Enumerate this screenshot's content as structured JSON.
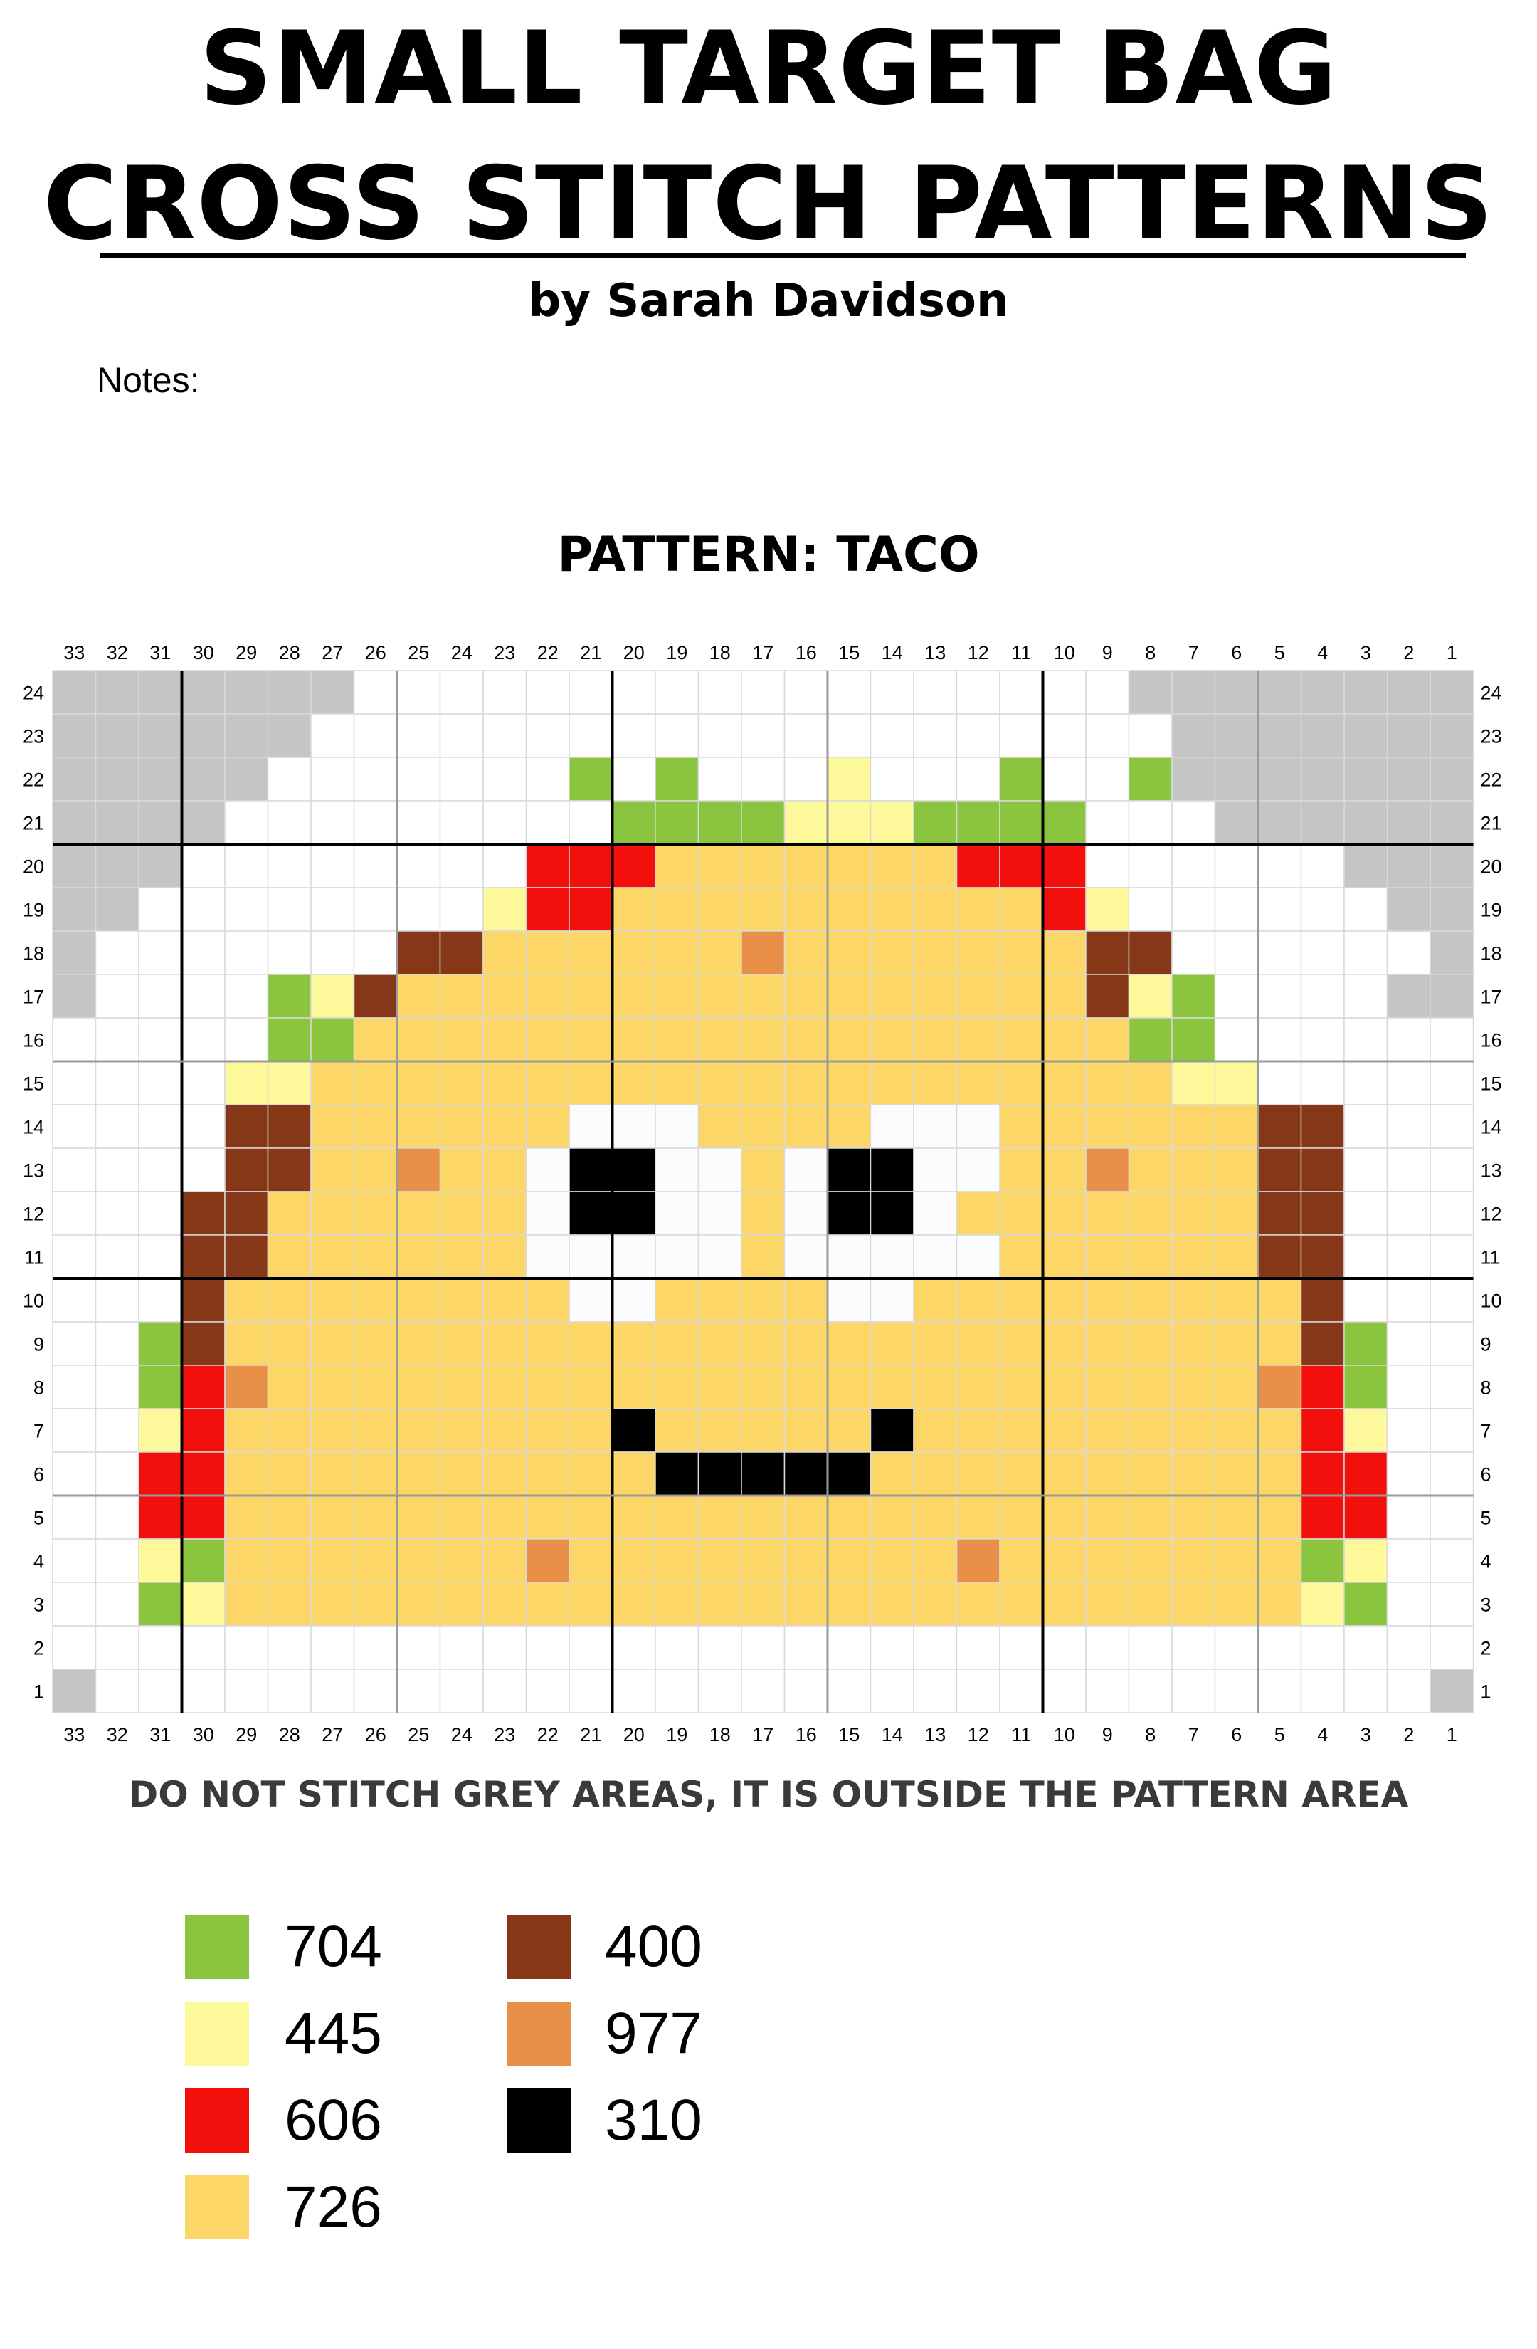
{
  "header": {
    "title_line1": "SMALL TARGET BAG",
    "title_line2": "CROSS STITCH PATTERNS",
    "byline": "by Sarah Davidson",
    "notes_label": "Notes:"
  },
  "pattern": {
    "title": "PATTERN: TACO",
    "columns": 33,
    "rows": 24,
    "column_numbering": "right-to-left (33 at left, 1 at right)",
    "row_numbering": "bottom-to-top (1 at bottom, 24 at top)",
    "bold_grid_every": 10,
    "light_grid_every": 5,
    "grid_rows_top_to_bottom": [
      "GGGGGGG..........................GGGGGGGG",
      "GGGGGG...........................GGGGGGG",
      "GGGGG.......V.V...Y...V..V.......GGGGGGG",
      "GGGG.........VVVVYYYVVVV.........GGGGGG",
      "GGG........RRRKKKKKKKRRR.......GGG",
      "GG........YRRKKKKKKKKKKRY......GG",
      "G.......BBKKKKKKOKKKKKKKBB......G",
      "G....VYBKKKKKKKKKKKKKKKKBYV....G",
      ".....VVKKKKKKKKKKKKKKKKKKVV.....",
      "....YYKKKKKKKKKKKKKKKKKKKKYY....",
      "....BBKKKKKKWWWKKKKWWWKKKKKKBB...",
      "....BBKKOKKWDDWWKWDDWWKKOKKKBB...",
      "...BBKKKKKKWDDWWKWDDWKKKKKKKBB..",
      "...BBKKKKKKWWWWWKWWWWWKKKKKKBB..",
      "...BKKKKKKKKWWKKKKWWKKKKKKKKKB..",
      "..VBKKKKKKKKKKKKKKKKKKKKKKKKKBV.",
      "..VROKKKKKKKKKKKKKKKKKKKKKKKORV.",
      "..YRKKKKKKKKKDKKKKKDKKKKKKKKKRY.",
      "..RRKKKKKKKKKKDDDDDKKKKKKKKKKRR.",
      "..RRKKKKKKKKKKKKKKKKKKKKKKKKKRR.",
      "..YVKKKKKKKOKKKKKKKKKOKKKKKKKVY.",
      "..VYKKKKKKKKKKKKKKKKKKKKKKKKKYV.",
      "...............................",
      "G...............................G"
    ],
    "cell_colors": {
      "G": "#c4c6c3",
      ".": "#ffffff",
      "V": "#8bc53f",
      "Y": "#fdf89a",
      "R": "#f20f0c",
      "K": "#fcd767",
      "B": "#853717",
      "O": "#e89047",
      "D": "#000000",
      "W": "#fcfcff"
    }
  },
  "warning": "DO NOT STITCH GREY AREAS, IT IS OUTSIDE THE PATTERN AREA",
  "legend": {
    "left_column": [
      {
        "code": "704",
        "color": "#8bc53f"
      },
      {
        "code": "445",
        "color": "#fdf89a"
      },
      {
        "code": "606",
        "color": "#f20f0c"
      },
      {
        "code": "726",
        "color": "#fcd767"
      }
    ],
    "right_column": [
      {
        "code": "400",
        "color": "#853717"
      },
      {
        "code": "977",
        "color": "#e89047"
      },
      {
        "code": "310",
        "color": "#000000"
      }
    ]
  }
}
